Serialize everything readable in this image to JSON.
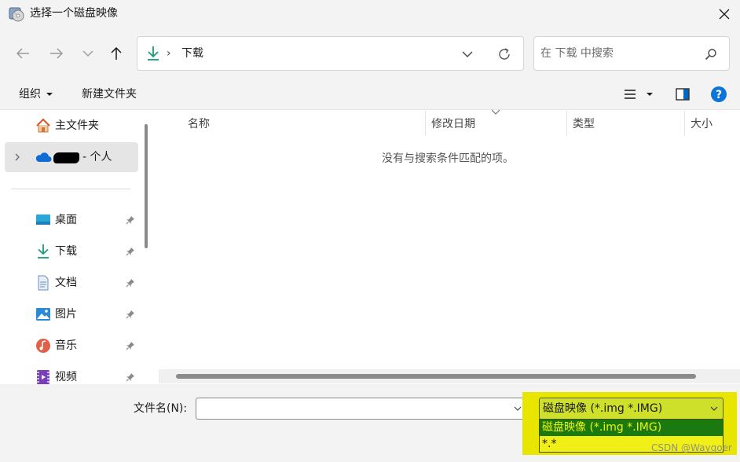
{
  "window": {
    "title": "选择一个磁盘映像",
    "close_icon": "close-icon",
    "app_icon": "disc-image-app-icon"
  },
  "nav": {
    "back_icon": "arrow-left-icon",
    "forward_icon": "arrow-right-icon",
    "recent_icon": "chevron-down-icon",
    "up_icon": "arrow-up-icon",
    "address": {
      "location_icon": "download-icon",
      "separator": "›",
      "path": "下载"
    },
    "refresh_icon": "refresh-icon",
    "search": {
      "placeholder": "在 下载 中搜索",
      "value": "",
      "icon": "search-icon"
    }
  },
  "toolbar": {
    "organize_label": "组织",
    "new_folder_label": "新建文件夹",
    "view_icon": "list-view-icon",
    "preview_icon": "preview-pane-icon",
    "help_icon": "help-icon"
  },
  "sidebar": {
    "home": {
      "label": "主文件夹",
      "icon": "home-icon"
    },
    "onedrive": {
      "label": "- 个人",
      "icon": "onedrive-cloud-icon"
    },
    "quick_access": [
      {
        "label": "桌面",
        "icon": "desktop-icon",
        "pinned": true
      },
      {
        "label": "下载",
        "icon": "download-icon",
        "pinned": true
      },
      {
        "label": "文档",
        "icon": "document-icon",
        "pinned": true
      },
      {
        "label": "图片",
        "icon": "pictures-icon",
        "pinned": true
      },
      {
        "label": "音乐",
        "icon": "music-icon",
        "pinned": true
      },
      {
        "label": "视频",
        "icon": "video-icon",
        "pinned": true
      }
    ]
  },
  "file_list": {
    "columns": [
      "名称",
      "修改日期",
      "类型",
      "大小"
    ],
    "empty_message": "没有与搜索条件匹配的项。"
  },
  "bottom": {
    "filename_label": "文件名(N):",
    "filename_value": "",
    "filter": {
      "selected": "磁盘映像 (*.img *.IMG)",
      "options": [
        "磁盘映像 (*.img *.IMG)",
        "*.*"
      ]
    }
  },
  "watermark": "CSDN @Waygoer",
  "colors": {
    "chrome_bg": "#f3f3f3",
    "accent_blue": "#0067c0",
    "highlight_yellow": "#e8e600",
    "selected_option_green": "#1a7a10"
  }
}
